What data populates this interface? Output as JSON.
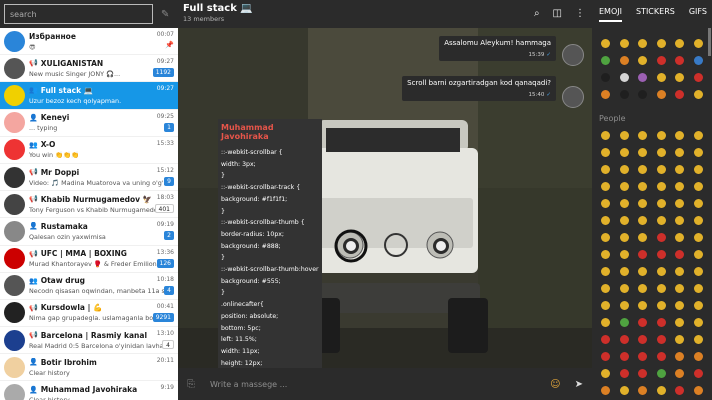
{
  "sidebar": {
    "search_placeholder": "search",
    "chats": [
      {
        "name": "Избранное",
        "msg": "😎",
        "time": "00:07",
        "pin": true,
        "icon": "",
        "av": "#2a85d9",
        "active": false
      },
      {
        "name": "XULIGANISTAN",
        "msg": "New music Singer JONY 🎧...",
        "time": "09:27",
        "badge": "1192",
        "icon": "📢",
        "av": "#555",
        "active": false
      },
      {
        "name": "Full stack 💻",
        "msg": "Uzur bezoz kech qolyapman.",
        "time": "09:27",
        "icon": "👥",
        "av": "#f0d000",
        "active": true
      },
      {
        "name": "Keneyi",
        "msg": "... typing",
        "time": "09:25",
        "badge": "1",
        "icon": "👤",
        "av": "#f4a6a0",
        "active": false
      },
      {
        "name": "X-O",
        "msg": "You win 👏👏👏",
        "time": "15:33",
        "icon": "👥",
        "av": "#e33",
        "active": false
      },
      {
        "name": "Mr Doppi",
        "msg": "Video: 🎵 Madina Muatorova va uning o'g'li",
        "time": "15:12",
        "badge": "9",
        "icon": "📢",
        "av": "#333",
        "active": false
      },
      {
        "name": "Khabib Nurmugamedov 🦅",
        "msg": "Tony Ferguson vs Khabib Nurmugamedov",
        "time": "18:03",
        "badge": "401",
        "badgeWhite": true,
        "icon": "📢",
        "av": "#444",
        "active": false
      },
      {
        "name": "Rustamaka",
        "msg": "Qalesan ozin yaxwimisa",
        "time": "09:19",
        "badge": "2",
        "icon": "👤",
        "av": "#888",
        "active": false
      },
      {
        "name": "UFC | MMA | BOXING",
        "msg": "Murad Khantorayev 🥊 & Freder Emilionko",
        "time": "13:36",
        "badge": "126",
        "icon": "📢",
        "av": "#c00",
        "active": false
      },
      {
        "name": "Otaw drug",
        "msg": "Necodn qisasan oqwindan, manbeta 11a san",
        "time": "10:18",
        "badge": "4",
        "icon": "👥",
        "av": "#555",
        "active": false
      },
      {
        "name": "Kursdowla | 💪",
        "msg": "Nima gap grupadegla. uslamaganla bomb",
        "time": "00:41",
        "badge": "9291",
        "icon": "📢",
        "av": "#222",
        "active": false
      },
      {
        "name": "Barcelona | Rasmiy kanal",
        "msg": "Real Madrid 0:5 Barcelona o'yinidan lavhalar.",
        "time": "13:10",
        "badge": "4",
        "badgeWhite": true,
        "icon": "📢",
        "av": "#1c3f8f",
        "active": false
      },
      {
        "name": "Botir Ibrohim",
        "msg": "Clear history",
        "time": "20:11",
        "icon": "👤",
        "av": "#f0d0a0",
        "active": false
      },
      {
        "name": "Muhammad Javohiraka",
        "msg": "Clear history",
        "time": "9:19",
        "icon": "👤",
        "av": "#aaa",
        "active": false
      }
    ]
  },
  "header": {
    "title": "Full stack 💻",
    "members": "13 members",
    "icons": [
      "search-icon",
      "columns-icon",
      "menu-icon"
    ]
  },
  "messages": {
    "out1": {
      "text": "Assalomu Aleykum! hammaga",
      "time": "15:39"
    },
    "out2": {
      "text": "Scroll barni ozgartiradgan kod qanaqadi?",
      "time": "15:40"
    },
    "code": {
      "author": "Muhammad Javohiraka",
      "lines": [
        "::-webkit-scrollbar {",
        "width: 3px;",
        "}",
        "::-webkit-scrollbar-track {",
        "background: #f1f1f1;",
        "}",
        "::-webkit-scrollbar-thumb {",
        "border-radius: 10px;",
        "background: #888;",
        "}",
        "::-webkit-scrollbar-thumb:hover {",
        "background: #555;",
        "}",
        ".onlinecafter{",
        "position: absolute;",
        "bottom: 5pc;",
        "left: 11.5%;",
        "width: 11px;",
        "height: 12px;",
        "background-color: #3b75bc;",
        "border: 1px solid #000;",
        "border-radius: 50%;",
        "content: \"\";"
      ]
    }
  },
  "composer": {
    "placeholder": "Write a massege ..."
  },
  "right_panel": {
    "tabs": [
      "EMOJI",
      "STICKERS",
      "GIFS"
    ],
    "active_tab": "EMOJI",
    "people_label": "People"
  },
  "colors": {
    "accent": "#1697e7",
    "dark": "#2b2b2b",
    "code_author": "#e6554a"
  }
}
